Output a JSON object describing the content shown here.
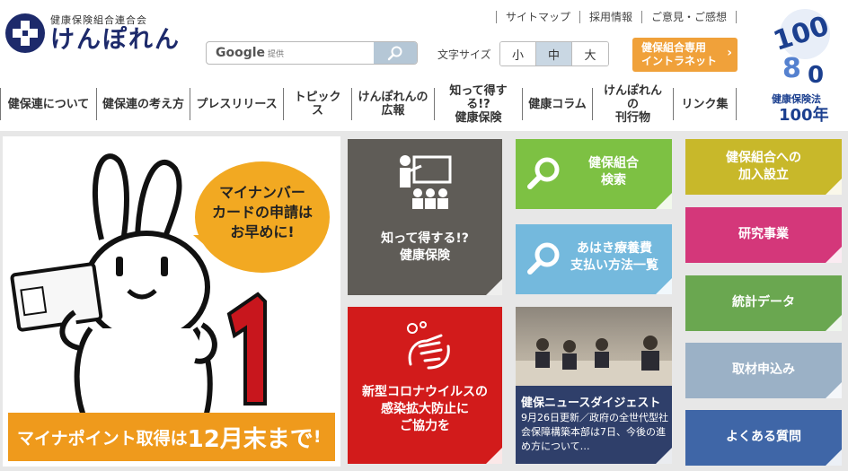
{
  "header": {
    "logo_sub": "健康保険組合連合会",
    "logo_main": "けんぽれん",
    "top_links": [
      "サイトマップ",
      "採用情報",
      "ご意見・ご感想"
    ],
    "search": {
      "brand": "Google",
      "brand_sub": "提供",
      "placeholder": ""
    },
    "font_size_label": "文字サイズ",
    "font_sizes": [
      "小",
      "中",
      "大"
    ],
    "font_size_selected": "中",
    "intranet_line1": "健保組合専用",
    "intranet_line2": "イントラネット",
    "badge_caption": "健康保険法",
    "badge_big": "100年",
    "badge_graphic": "100"
  },
  "nav": [
    "健保連について",
    "健保連の考え方",
    "プレスリリース",
    "トピックス",
    "けんぽれんの\n広報",
    "知って得する!?\n健康保険",
    "健康コラム",
    "けんぽれんの\n刊行物",
    "リンク集"
  ],
  "hero": {
    "bubble": "マイナンバー\nカードの申請は\nお早めに!",
    "banner_prefix": "マイナポイント取得は",
    "banner_big": "12月末まで",
    "banner_suffix": "!",
    "big_number": "1"
  },
  "tiles": {
    "shitte": "知って得する!?\n健康保険",
    "corona": "新型コロナウイルスの\n感染拡大防止に\nご協力を",
    "search": "健保組合\n検索",
    "ahaki": "あはき療養費\n支払い方法一覧",
    "join": "健保組合への\n加入設立",
    "research": "研究事業",
    "stats": "統計データ",
    "press": "取材申込み",
    "faq": "よくある質問"
  },
  "news": {
    "title": "健保ニュースダイジェスト",
    "body": "9月26日更新／政府の全世代型社会保障構築本部は7日、今後の進め方について…"
  },
  "colors": {
    "brand_navy": "#1d2a6b",
    "intranet": "#f0a13a",
    "hero_orange": "#ef9a1c"
  }
}
